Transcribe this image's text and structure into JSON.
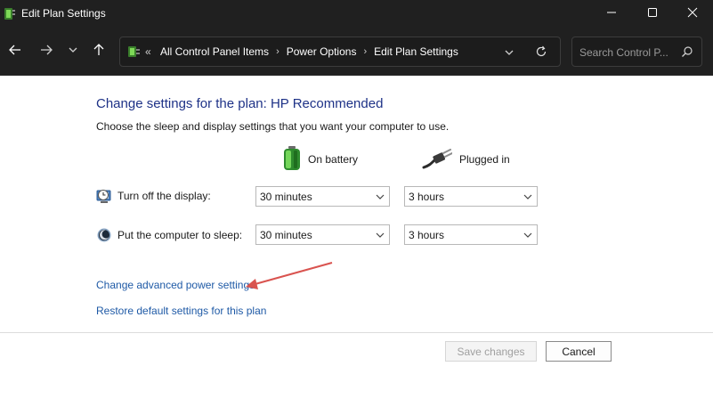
{
  "window": {
    "title": "Edit Plan Settings"
  },
  "nav": {
    "breadcrumbs": [
      "All Control Panel Items",
      "Power Options",
      "Edit Plan Settings"
    ],
    "search_placeholder": "Search Control P..."
  },
  "main": {
    "heading": "Change settings for the plan: HP Recommended",
    "subtext": "Choose the sleep and display settings that you want your computer to use.",
    "columns": {
      "battery": "On battery",
      "plugged": "Plugged in"
    },
    "rows": [
      {
        "label": "Turn off the display:",
        "battery": "30 minutes",
        "plugged": "3 hours"
      },
      {
        "label": "Put the computer to sleep:",
        "battery": "30 minutes",
        "plugged": "3 hours"
      }
    ],
    "links": {
      "advanced": "Change advanced power settings",
      "restore": "Restore default settings for this plan"
    }
  },
  "footer": {
    "save": "Save changes",
    "cancel": "Cancel"
  },
  "colors": {
    "heading": "#1e3287",
    "link": "#1f5aa6",
    "titlebar": "#202020",
    "annotation_arrow": "#d9534f"
  },
  "icons": [
    "power-options-icon",
    "battery-icon",
    "plug-icon",
    "display-timer-icon",
    "sleep-moon-icon"
  ]
}
